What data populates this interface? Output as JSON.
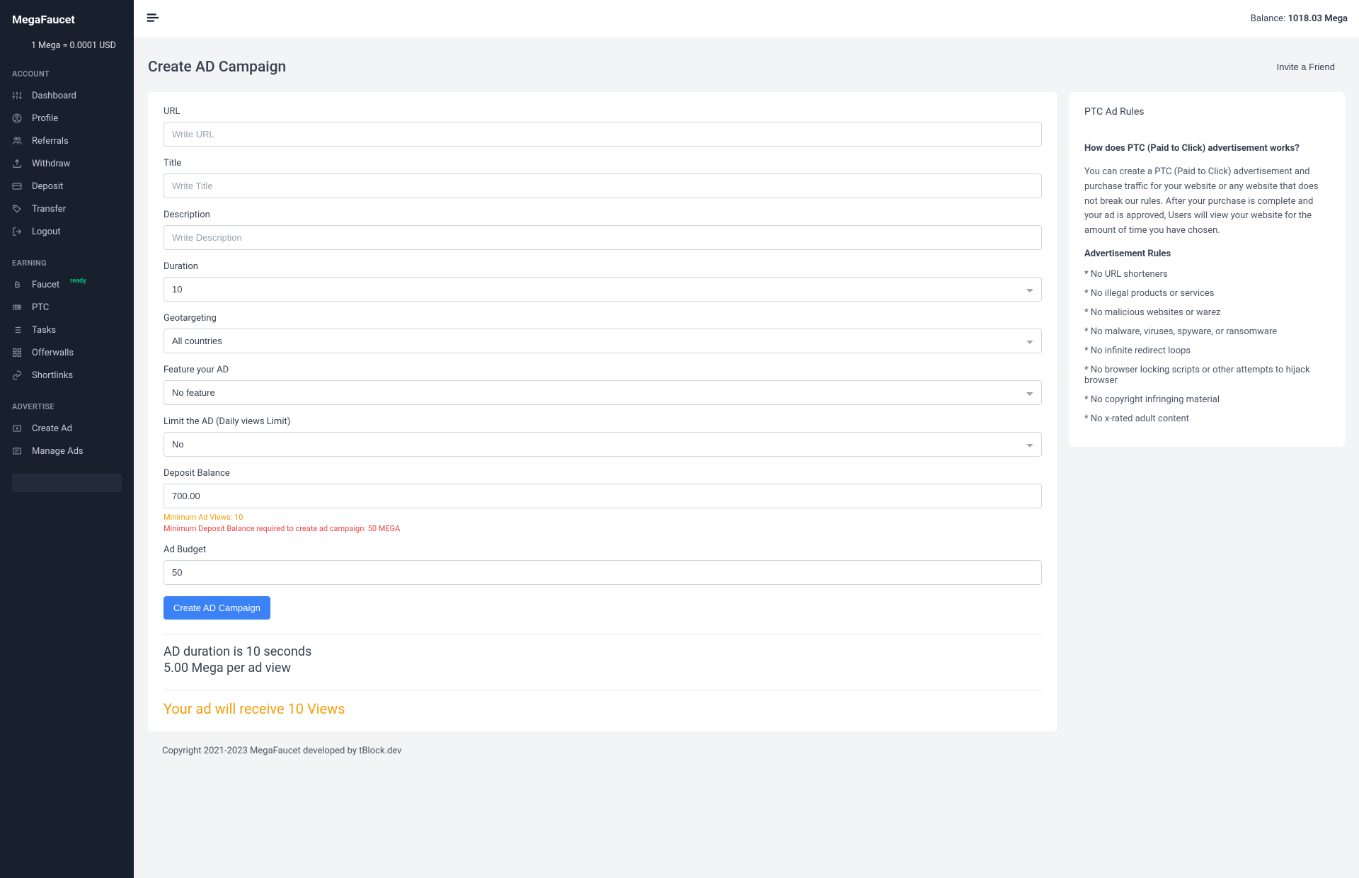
{
  "brand": "MegaFaucet",
  "exchange_rate": "1 Mega = 0.0001 USD",
  "topbar": {
    "balance_prefix": "Balance: ",
    "balance_value": "1018.03 Mega"
  },
  "sections": {
    "account": "ACCOUNT",
    "earning": "EARNING",
    "advertise": "ADVERTISE"
  },
  "nav": {
    "dashboard": "Dashboard",
    "profile": "Profile",
    "referrals": "Referrals",
    "withdraw": "Withdraw",
    "deposit": "Deposit",
    "transfer": "Transfer",
    "logout": "Logout",
    "faucet": "Faucet",
    "faucet_badge": "ready",
    "ptc": "PTC",
    "tasks": "Tasks",
    "offerwalls": "Offerwalls",
    "shortlinks": "Shortlinks",
    "create_ad": "Create Ad",
    "manage_ads": "Manage Ads"
  },
  "page": {
    "title": "Create AD Campaign",
    "invite": "Invite a Friend"
  },
  "form": {
    "url_label": "URL",
    "url_placeholder": "Write URL",
    "title_label": "Title",
    "title_placeholder": "Write Title",
    "desc_label": "Description",
    "desc_placeholder": "Write Description",
    "duration_label": "Duration",
    "duration_value": "10",
    "geo_label": "Geotargeting",
    "geo_value": "All countries",
    "feature_label": "Feature your AD",
    "feature_value": "No feature",
    "limit_label": "Limit the AD (Daily views Limit)",
    "limit_value": "No",
    "deposit_label": "Deposit Balance",
    "deposit_value": "700.00",
    "hint_min_views": "Minimum Ad Views: 10",
    "hint_min_deposit": "Minimum Deposit Balance required to create ad campaign: 50 MEGA",
    "budget_label": "Ad Budget",
    "budget_value": "50",
    "submit": "Create AD Campaign"
  },
  "summary": {
    "duration_line": "AD duration is 10 seconds",
    "cost_line": "5.00 Mega per ad view",
    "views_line": "Your ad will receive 10 Views"
  },
  "rules": {
    "title": "PTC Ad Rules",
    "q": "How does PTC (Paid to Click) advertisement works?",
    "p": "You can create a PTC (Paid to Click) advertisement and purchase traffic for your website or any website that does not break our rules. After your purchase is complete and your ad is approved, Users will view your website for the amount of time you have chosen.",
    "h": "Advertisement Rules",
    "items": [
      "* No URL shorteners",
      "* No illegal products or services",
      "* No malicious websites or warez",
      "* No malware, viruses, spyware, or ransomware",
      "* No infinite redirect loops",
      "* No browser locking scripts or other attempts to hijack browser",
      "* No copyright infringing material",
      "* No x-rated adult content"
    ]
  },
  "footer": "Copyright 2021-2023 MegaFaucet developed by tBlock.dev"
}
